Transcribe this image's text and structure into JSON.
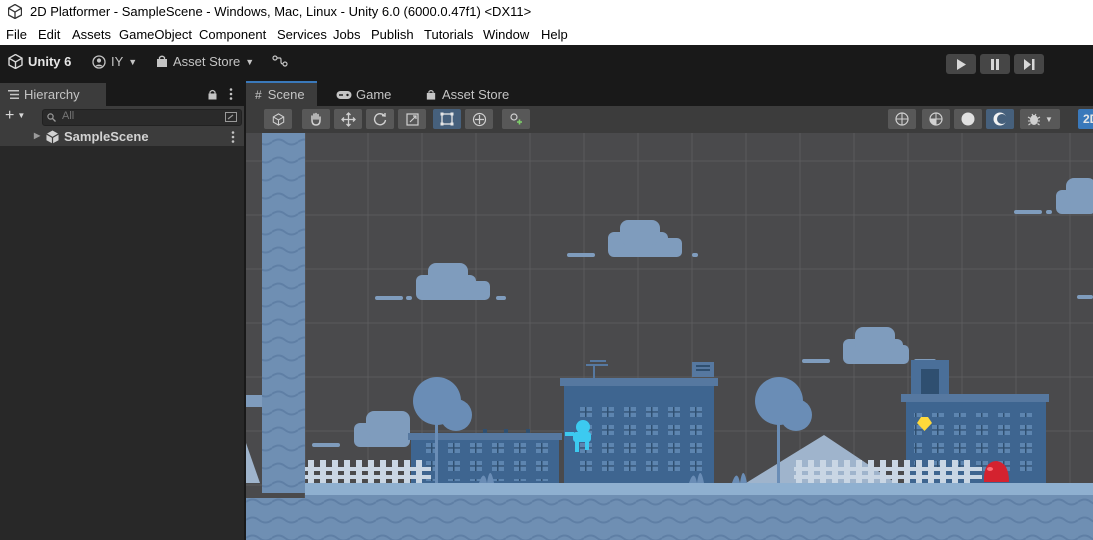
{
  "window": {
    "title": "2D Platformer - SampleScene - Windows, Mac, Linux - Unity 6.0 (6000.0.47f1) <DX11>"
  },
  "menu": {
    "items": [
      "File",
      "Edit",
      "Assets",
      "GameObject",
      "Component",
      "Services",
      "Jobs",
      "Publish",
      "Tutorials",
      "Window",
      "Help"
    ]
  },
  "toolbar": {
    "brand_label": "Unity 6",
    "account_label": "IY",
    "asset_store_label": "Asset Store"
  },
  "hierarchy": {
    "tab_label": "Hierarchy",
    "search_placeholder": "All",
    "scene_name": "SampleScene"
  },
  "scene_view": {
    "tabs": [
      "Scene",
      "Game",
      "Asset Store"
    ],
    "active_tab": "Scene",
    "active_tool": "rect-tool",
    "shading_mode": "2D",
    "background_color": "#4a4a4c",
    "accent_color": "#4d6f95"
  }
}
